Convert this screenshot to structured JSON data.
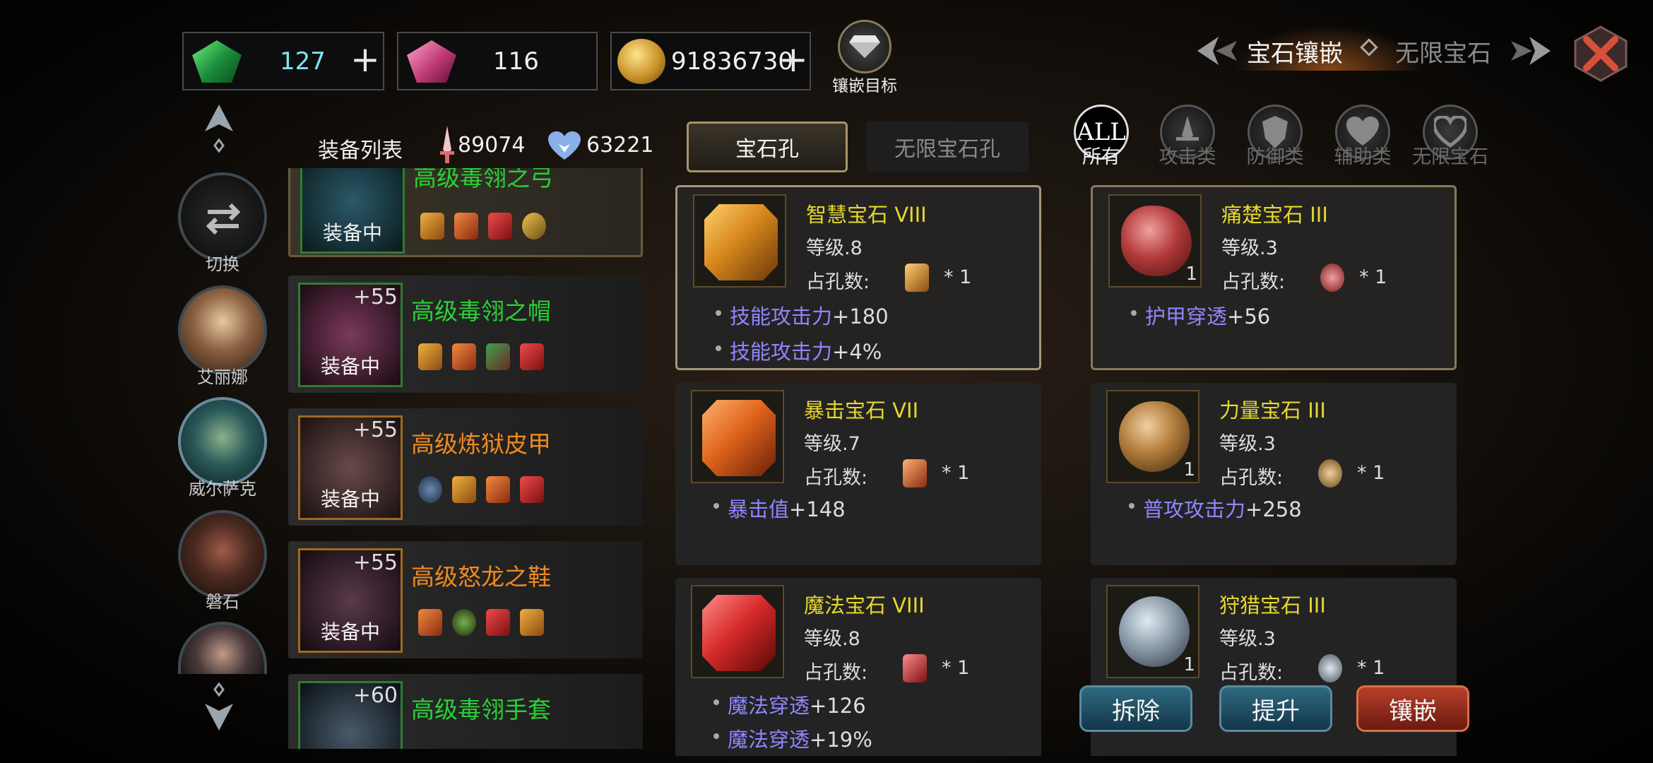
{
  "top": {
    "emerald": {
      "value": "127",
      "plus": "+"
    },
    "ruby": {
      "value": "116"
    },
    "gold": {
      "value": "91836730",
      "plus": "+"
    },
    "target": {
      "label": "镶嵌目标"
    },
    "tabs": {
      "active": "宝石镶嵌",
      "inactive": "无限宝石"
    }
  },
  "left": {
    "switch_label": "切换",
    "heroes": [
      "艾丽娜",
      "威尔萨克",
      "磐石"
    ]
  },
  "list": {
    "title": "装备列表",
    "attack": "89074",
    "defense": "63221",
    "items": [
      {
        "name": "高级毒翎之弓",
        "plus": "",
        "status": "装备中",
        "color": "#29d235"
      },
      {
        "name": "高级毒翎之帽",
        "plus": "+55",
        "status": "装备中",
        "color": "#29d235"
      },
      {
        "name": "高级炼狱皮甲",
        "plus": "+55",
        "status": "装备中",
        "color": "#f08a1e"
      },
      {
        "name": "高级怒龙之鞋",
        "plus": "+55",
        "status": "装备中",
        "color": "#f08a1e"
      },
      {
        "name": "高级毒翎手套",
        "plus": "+60",
        "status": "",
        "color": "#29d235"
      }
    ]
  },
  "tabs": {
    "slot": "宝石孔",
    "infinite_slot": "无限宝石孔"
  },
  "categories": [
    {
      "icon": "ALL",
      "label": "所有"
    },
    {
      "icon": "attack",
      "label": "攻击类"
    },
    {
      "icon": "defense",
      "label": "防御类"
    },
    {
      "icon": "support",
      "label": "辅助类"
    },
    {
      "icon": "infinite",
      "label": "无限宝石"
    }
  ],
  "gems": [
    {
      "name": "智慧宝石 VIII",
      "level": "等级.8",
      "slots_label": "占孔数:",
      "slots": "* 1",
      "count": "",
      "attrs": [
        {
          "k": "技能攻击力",
          "v": "+180"
        },
        {
          "k": "技能攻击力",
          "v": "+4%"
        }
      ],
      "color": "#e08a1c"
    },
    {
      "name": "痛楚宝石 III",
      "level": "等级.3",
      "slots_label": "占孔数:",
      "slots": "* 1",
      "count": "1",
      "attrs": [
        {
          "k": "护甲穿透",
          "v": "+56"
        }
      ],
      "color": "#b23a3a"
    },
    {
      "name": "暴击宝石 VII",
      "level": "等级.7",
      "slots_label": "占孔数:",
      "slots": "* 1",
      "count": "",
      "attrs": [
        {
          "k": "暴击值",
          "v": "+148"
        }
      ],
      "color": "#e0641c"
    },
    {
      "name": "力量宝石 III",
      "level": "等级.3",
      "slots_label": "占孔数:",
      "slots": "* 1",
      "count": "1",
      "attrs": [
        {
          "k": "普攻攻击力",
          "v": "+258"
        }
      ],
      "color": "#b07a3a"
    },
    {
      "name": "魔法宝石 VIII",
      "level": "等级.8",
      "slots_label": "占孔数:",
      "slots": "* 1",
      "count": "",
      "attrs": [
        {
          "k": "魔法穿透",
          "v": "+126"
        },
        {
          "k": "魔法穿透",
          "v": "+19%"
        }
      ],
      "color": "#d82a2a"
    },
    {
      "name": "狩猎宝石 III",
      "level": "等级.3",
      "slots_label": "占孔数:",
      "slots": "* 1",
      "count": "1",
      "attrs": [],
      "color": "#8a9aa8"
    }
  ],
  "actions": {
    "remove": "拆除",
    "upgrade": "提升",
    "inlay": "镶嵌"
  }
}
